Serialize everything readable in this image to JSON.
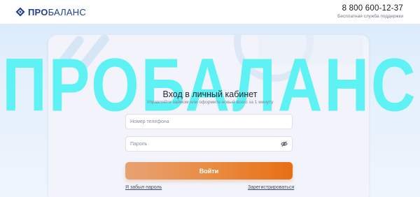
{
  "header": {
    "brand_prefix": "ПРО",
    "brand_suffix": "БАЛАНС",
    "phone": "8 800 600-12-37",
    "support_label": "Бесплатная служба поддержки"
  },
  "watermark": "ПРОБАЛАНС",
  "login": {
    "title": "Вход в личный кабинет",
    "subtitle": "Управляйте займом или оформите новый всего за 1 минуту",
    "phone_placeholder": "Номер телефона",
    "password_placeholder": "Пароль",
    "submit_label": "Войти",
    "forgot_link": "Я забыл пароль",
    "register_link": "Зарегистрироваться"
  },
  "colors": {
    "brand": "#1f3f8f",
    "accent_orange": "#e76f14",
    "watermark": "#5ef2f5"
  },
  "icons": {
    "logo": "diamond-logo-icon",
    "password_toggle": "eye-off-icon"
  }
}
